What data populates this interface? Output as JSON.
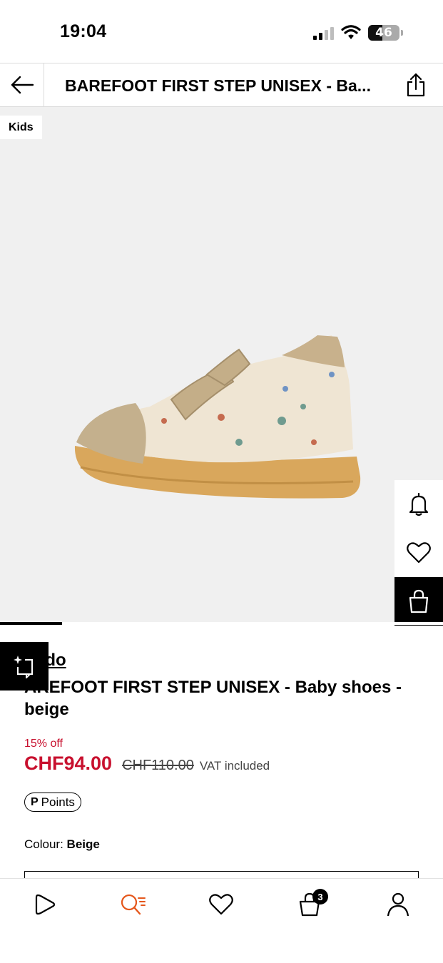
{
  "status_bar": {
    "time": "19:04",
    "battery": "46",
    "icons": [
      "signal-icon",
      "wifi-icon",
      "battery-icon"
    ]
  },
  "header": {
    "title": "BAREFOOT FIRST STEP UNISEX - Ba...",
    "back_icon": "arrow-left-icon",
    "share_icon": "share-icon"
  },
  "gallery": {
    "badge": "Kids",
    "image_index": 1,
    "actions": [
      {
        "name": "notify",
        "icon": "bell-icon"
      },
      {
        "name": "wishlist",
        "icon": "heart-icon"
      },
      {
        "name": "add-to-bag",
        "icon": "shopping-bag-icon"
      }
    ]
  },
  "product": {
    "brand": "oddo",
    "name": "BAREFOOT FIRST STEP UNISEX - Baby shoes - beige",
    "name_visible": "AREFOOT FIRST STEP UNISEX - Baby shoes - beige",
    "discount": "15% off",
    "price": "CHF94.00",
    "old_price": "CHF110.00",
    "vat": "VAT included",
    "points_label": "Points",
    "points_icon": "P",
    "colour_label": "Colour:",
    "colour_value": "Beige"
  },
  "colors": {
    "accent": "#c8102e",
    "image_bg": "#f0f0f0",
    "dark": "#000000"
  },
  "bottom_nav": {
    "items": [
      {
        "name": "home",
        "icon": "play-icon"
      },
      {
        "name": "search",
        "icon": "search-icon",
        "active": true
      },
      {
        "name": "wishlist",
        "icon": "heart-icon"
      },
      {
        "name": "bag",
        "icon": "bag-icon",
        "badge": "3"
      },
      {
        "name": "account",
        "icon": "user-icon"
      }
    ]
  }
}
